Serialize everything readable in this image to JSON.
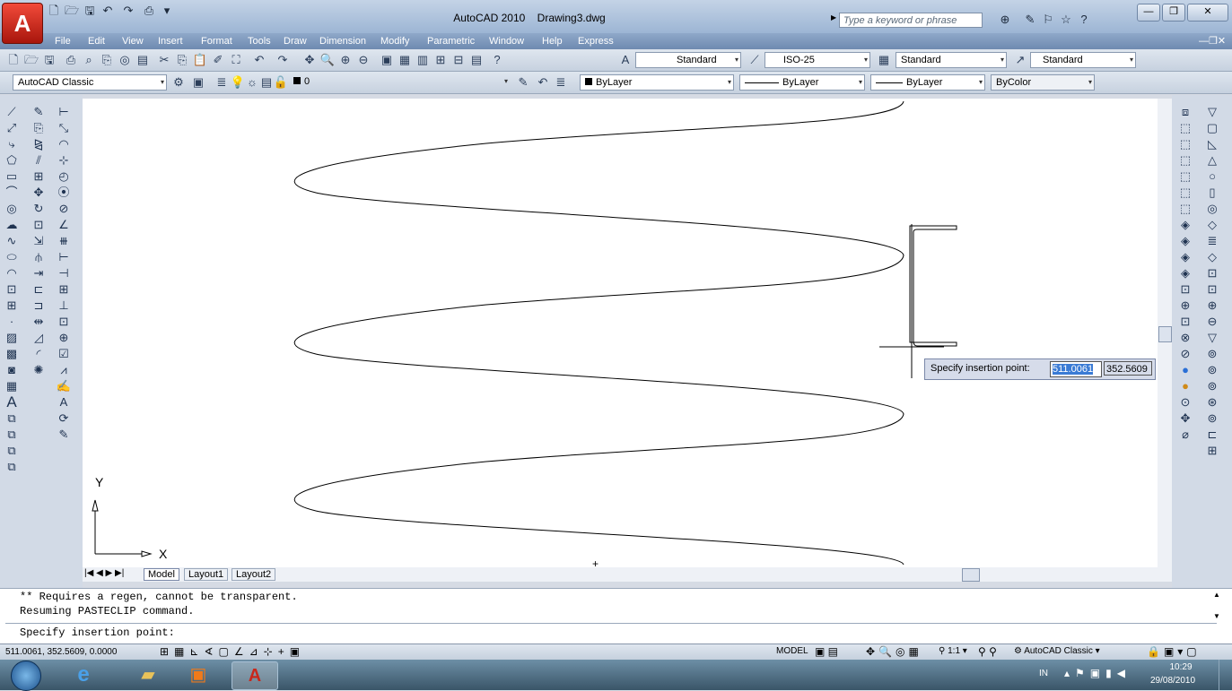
{
  "title": {
    "app": "AutoCAD 2010",
    "file": "Drawing3.dwg"
  },
  "search": {
    "placeholder": "Type a keyword or phrase"
  },
  "menu": [
    "File",
    "Edit",
    "View",
    "Insert",
    "Format",
    "Tools",
    "Draw",
    "Dimension",
    "Modify",
    "Parametric",
    "Window",
    "Help",
    "Express"
  ],
  "toolbar": {
    "text_style": "Standard",
    "dim_style": "ISO-25",
    "table_style": "Standard",
    "multileader_style": "Standard",
    "workspace": "AutoCAD Classic",
    "layer": "0",
    "color": "ByLayer",
    "linetype": "ByLayer",
    "lineweight": "ByLayer",
    "plotstyle": "ByColor"
  },
  "ucs": {
    "x": "X",
    "y": "Y"
  },
  "tabs": [
    "Model",
    "Layout1",
    "Layout2"
  ],
  "dynamic_input": {
    "prompt": "Specify insertion point:",
    "x": "511.0061",
    "y": "352.5609"
  },
  "command": {
    "history": [
      "** Requires a regen, cannot be transparent.",
      "Resuming PASTECLIP command."
    ],
    "prompt": "Specify insertion point:"
  },
  "status": {
    "coords": "511.0061, 352.5609, 0.0000",
    "model": "MODEL",
    "scale": "1:1",
    "workspace": "AutoCAD Classic"
  },
  "tray": {
    "lang": "IN",
    "time": "10:29",
    "date": "29/08/2010"
  },
  "colors": {
    "title": "#9cb5d4",
    "menubar": "#6e8ab0",
    "accent": "#c8281c",
    "canvas": "#ffffff"
  }
}
